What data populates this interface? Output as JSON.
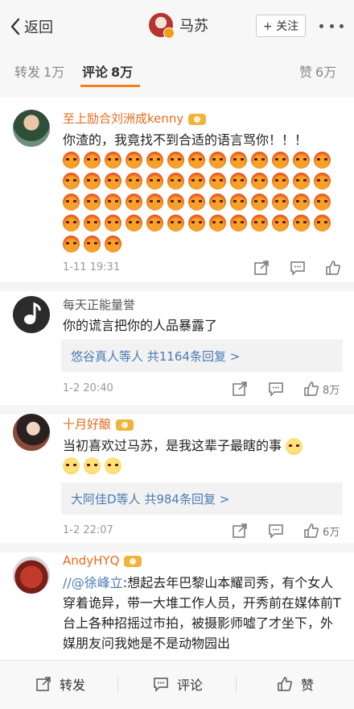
{
  "nav": {
    "back_label": "返回",
    "title": "马苏",
    "follow_label": "+ 关注"
  },
  "tabs": [
    {
      "label": "转发",
      "count": "1万"
    },
    {
      "label": "评论",
      "count": "8万"
    },
    {
      "label": "赞",
      "count": "6万"
    }
  ],
  "comments": [
    {
      "name": "至上励合刘洲成kenny",
      "text": "你渣的，我竟找不到合适的语言骂你！！！",
      "time": "1-11 19:31",
      "like_count": "",
      "emoji_count": 55
    },
    {
      "name": "每天正能量誉",
      "text": "你的谎言把你的人品暴露了",
      "reply_summary": "悠谷真人等人  共1164条回复 >",
      "time": "1-2 20:40",
      "like_count": "8万"
    },
    {
      "name": "十月好酿",
      "text": "当初喜欢过马苏，是我这辈子最瞎的事",
      "reply_summary": "大阿佳D等人  共984条回复 >",
      "time": "1-2 22:07",
      "like_count": "6万"
    },
    {
      "name": "AndyHYQ",
      "mention": "//@徐峰立",
      "text": ":想起去年巴黎山本耀司秀，有个女人穿着诡异，带一大堆工作人员，开秀前在媒体前T台上各种招摇过市拍，被摄影师嘘了才坐下，外媒朋友问我她是不是动物园出"
    }
  ],
  "bottom_bar": {
    "repost_label": "转发",
    "comment_label": "评论",
    "like_label": "赞"
  },
  "colors": {
    "accent": "#f57f1f",
    "name_orange": "#e96b1d",
    "link_blue": "#4b7bb5"
  }
}
